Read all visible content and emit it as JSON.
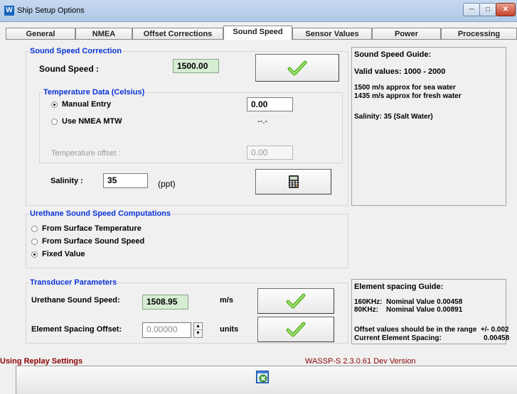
{
  "window": {
    "title": "Ship Setup Options",
    "app_icon_letter": "W"
  },
  "tabs": [
    {
      "label": "General"
    },
    {
      "label": "NMEA"
    },
    {
      "label": "Offset Corrections"
    },
    {
      "label": "Sound Speed"
    },
    {
      "label": "Sensor Values"
    },
    {
      "label": "Power"
    },
    {
      "label": "Processing"
    }
  ],
  "active_tab": "Sound Speed",
  "sound_speed_correction": {
    "title": "Sound Speed Correction",
    "sound_speed_label": "Sound Speed :",
    "sound_speed_value": "1500.00",
    "temperature": {
      "title": "Temperature Data (Celsius)",
      "manual_entry_label": "Manual Entry",
      "manual_entry_value": "0.00",
      "use_nmea_label": "Use NMEA MTW",
      "nmea_value": "--.-",
      "offset_label": "Temperature offset :",
      "offset_value": "0.00"
    },
    "salinity_label": "Salinity :",
    "salinity_value": "35",
    "salinity_unit": "(ppt)"
  },
  "sound_speed_guide": {
    "title": "Sound Speed Guide:",
    "valid": "Valid values: 1000 - 2000",
    "sea": "1500 m/s approx for sea water",
    "fresh": "1435 m/s approx for fresh water",
    "salinity": "Salinity: 35 (Salt Water)"
  },
  "urethane": {
    "title": "Urethane Sound Speed Computations",
    "options": [
      {
        "label": "From Surface Temperature",
        "selected": false
      },
      {
        "label": "From Surface Sound Speed",
        "selected": false
      },
      {
        "label": "Fixed Value",
        "selected": true
      }
    ]
  },
  "transducer": {
    "title": "Transducer Parameters",
    "urethane_speed_label": "Urethane Sound Speed:",
    "urethane_speed_value": "1508.95",
    "urethane_speed_unit": "m/s",
    "spacing_label": "Element Spacing Offset:",
    "spacing_value": "0.00000",
    "spacing_unit": "units"
  },
  "element_guide": {
    "title": "Element spacing Guide:",
    "line1": "160KHz:  Nominal Value 0.00458",
    "line2": "80KHz:    Nominal Value 0.00891",
    "line3": "Offset values should be in the range  +/- 0.002",
    "current_label": "Current Element Spacing:",
    "current_value": "0.00458"
  },
  "status": {
    "left": "Using Replay Settings",
    "version": "WASSP-S 2.3.0.61 Dev Version"
  },
  "colors": {
    "group_title": "#0b33d6",
    "status_text": "#8b0000",
    "green_field": "#d6edd3"
  }
}
